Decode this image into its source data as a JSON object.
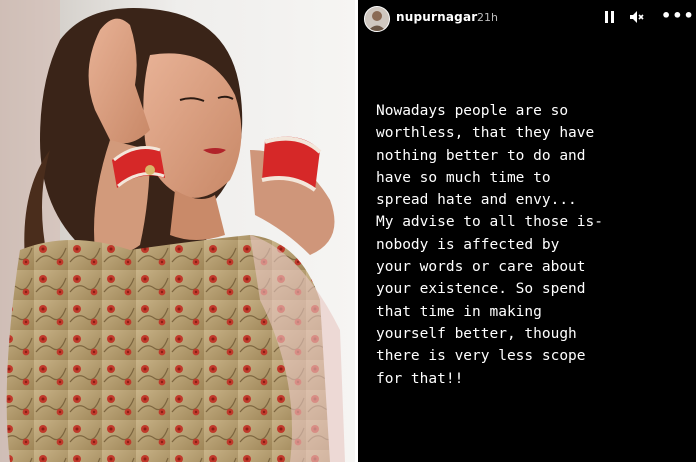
{
  "story": {
    "username": "nupurnagar",
    "timestamp": "21h",
    "more_glyph": "•••",
    "caption_lines": [
      "Nowadays people are so",
      "worthless, that they have",
      "nothing better to do and",
      "have so much time to",
      "spread hate and envy...",
      "My advise to all those is-",
      "nobody is affected by",
      "your words or care about",
      "your existence. So spend",
      "that time in making",
      "yourself better, though",
      "there is very less scope",
      "for that!!"
    ]
  },
  "icons": {
    "avatar": "profile-avatar",
    "pause": "pause-icon",
    "mute": "mute-icon",
    "more": "more-options-icon"
  },
  "colors": {
    "story_background": "#000000",
    "text": "#ffffff",
    "muted_text": "#bdbdbd",
    "blouse": "#b7a173",
    "embroidery": "#c0392b",
    "bangles": "#d62828"
  }
}
